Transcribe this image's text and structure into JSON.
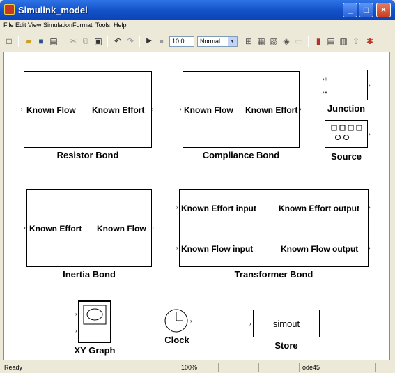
{
  "window": {
    "title": "Simulink_model"
  },
  "menu": [
    "File",
    "Edit",
    "View",
    "Simulation",
    "Format",
    "Tools",
    "Help"
  ],
  "toolbar": {
    "stop_time": "10.0",
    "sim_mode": "Normal"
  },
  "blocks": {
    "resistor": {
      "name": "Resistor Bond",
      "in": "Known Flow",
      "out": "Known Effort"
    },
    "compliance": {
      "name": "Compliance Bond",
      "in": "Known Flow",
      "out": "Known  Effort"
    },
    "junction": {
      "name": "Junction"
    },
    "source": {
      "name": "Source"
    },
    "inertia": {
      "name": "Inertia Bond",
      "in": "Known Effort",
      "out": "Known Flow"
    },
    "transformer": {
      "name": "Transformer Bond",
      "in1": "Known Effort input",
      "out1": "Known Effort output",
      "in2": "Known Flow input",
      "out2": "Known  Flow output"
    },
    "xygraph": {
      "name": "XY Graph"
    },
    "clock": {
      "name": "Clock"
    },
    "store": {
      "name": "Store",
      "label": "simout"
    }
  },
  "status": {
    "state": "Ready",
    "zoom": "100%",
    "solver": "ode45"
  }
}
